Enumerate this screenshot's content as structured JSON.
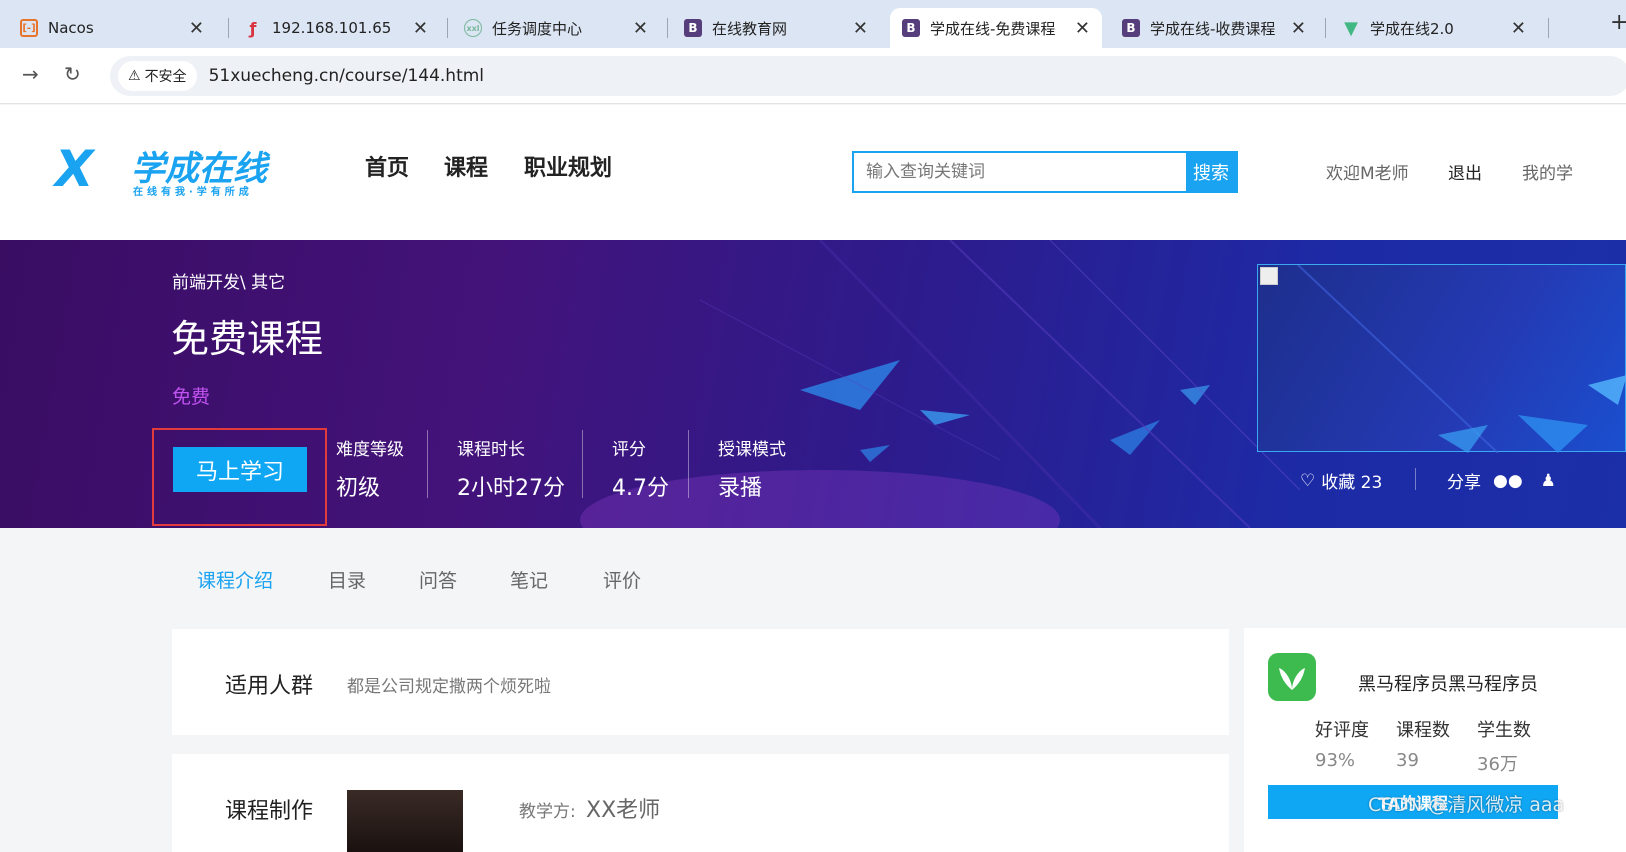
{
  "browser": {
    "tabs": [
      {
        "label": "Nacos",
        "favicon": "nacos-icon",
        "color": "#e8742b",
        "active": false
      },
      {
        "label": "192.168.101.65",
        "favicon": "feather-icon",
        "color": "#d9333f",
        "active": false
      },
      {
        "label": "任务调度中心",
        "favicon": "xxl-job-icon",
        "color": "#7ab89a",
        "active": false
      },
      {
        "label": "在线教育网",
        "favicon": "bootstrap-icon",
        "color": "#563d7c",
        "active": false
      },
      {
        "label": "学成在线-免费课程",
        "favicon": "bootstrap-icon",
        "color": "#563d7c",
        "active": true
      },
      {
        "label": "学成在线-收费课程",
        "favicon": "bootstrap-icon",
        "color": "#563d7c",
        "active": false
      },
      {
        "label": "学成在线2.0",
        "favicon": "vue-icon",
        "color": "#41b883",
        "active": false
      }
    ],
    "insecure_label": "不安全",
    "url": "51xuecheng.cn/course/144.html"
  },
  "header": {
    "logo_text": "学成在线",
    "logo_sub": "在线有我·学有所成",
    "nav": [
      "首页",
      "课程",
      "职业规划"
    ],
    "search_placeholder": "输入查询关键词",
    "search_button": "搜索",
    "welcome": "欢迎M老师",
    "logout": "退出",
    "my_study": "我的学"
  },
  "course": {
    "breadcrumb": "前端开发\\ 其它",
    "title": "免费课程",
    "price": "免费",
    "study_button": "马上学习",
    "stats": [
      {
        "key": "难度等级",
        "value": "初级"
      },
      {
        "key": "课程时长",
        "value": "2小时27分"
      },
      {
        "key": "评分",
        "value": "4.7分"
      },
      {
        "key": "授课模式",
        "value": "录播"
      }
    ],
    "favorite": "收藏 23",
    "share": "分享"
  },
  "tabs": [
    "课程介绍",
    "目录",
    "问答",
    "笔记",
    "评价"
  ],
  "content": {
    "audience_title": "适用人群",
    "audience_text": "都是公司规定撒两个烦死啦",
    "production_title": "课程制作",
    "teacher_label": "教学方:",
    "teacher_name": "XX老师"
  },
  "org": {
    "name": "黑马程序员黑马程序员",
    "stats": [
      {
        "key": "好评度",
        "value": "93%"
      },
      {
        "key": "课程数",
        "value": "39"
      },
      {
        "key": "学生数",
        "value": "36万"
      }
    ],
    "ta_button": "TA的课程",
    "watermark": "CSDN @清风微凉 aaa"
  },
  "colors": {
    "accent": "#1aa3f0",
    "price": "#c052f0",
    "highlight": "#e23b3b"
  }
}
